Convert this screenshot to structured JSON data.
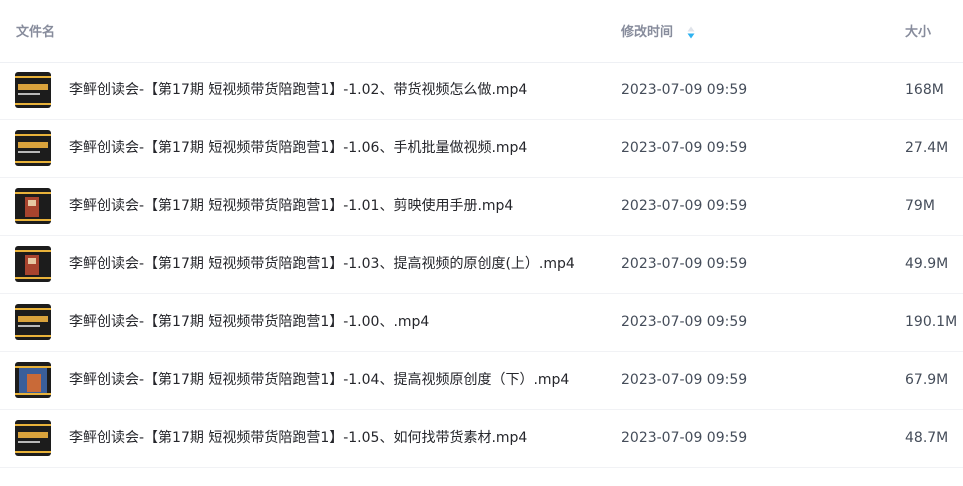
{
  "columns": {
    "name": "文件名",
    "modified": "修改时间",
    "size": "大小",
    "sort_icon": "sort-indicator-icon"
  },
  "accent_color": "#2fb2f0",
  "files": [
    {
      "name": "李鲆创读会-【第17期 短视频带货陪跑营1】-1.02、带货视频怎么做.mp4",
      "modified": "2023-07-09 09:59",
      "size": "168M",
      "thumbnail": "video-thumbnail"
    },
    {
      "name": "李鲆创读会-【第17期 短视频带货陪跑营1】-1.06、手机批量做视频.mp4",
      "modified": "2023-07-09 09:59",
      "size": "27.4M",
      "thumbnail": "video-thumbnail"
    },
    {
      "name": "李鲆创读会-【第17期 短视频带货陪跑营1】-1.01、剪映使用手册.mp4",
      "modified": "2023-07-09 09:59",
      "size": "79M",
      "thumbnail": "video-thumbnail"
    },
    {
      "name": "李鲆创读会-【第17期 短视频带货陪跑营1】-1.03、提高视频的原创度(上）.mp4",
      "modified": "2023-07-09 09:59",
      "size": "49.9M",
      "thumbnail": "video-thumbnail"
    },
    {
      "name": "李鲆创读会-【第17期 短视频带货陪跑营1】-1.00、.mp4",
      "modified": "2023-07-09 09:59",
      "size": "190.1M",
      "thumbnail": "video-thumbnail"
    },
    {
      "name": "李鲆创读会-【第17期 短视频带货陪跑营1】-1.04、提高视频原创度（下）.mp4",
      "modified": "2023-07-09 09:59",
      "size": "67.9M",
      "thumbnail": "video-thumbnail"
    },
    {
      "name": "李鲆创读会-【第17期 短视频带货陪跑营1】-1.05、如何找带货素材.mp4",
      "modified": "2023-07-09 09:59",
      "size": "48.7M",
      "thumbnail": "video-thumbnail"
    }
  ]
}
